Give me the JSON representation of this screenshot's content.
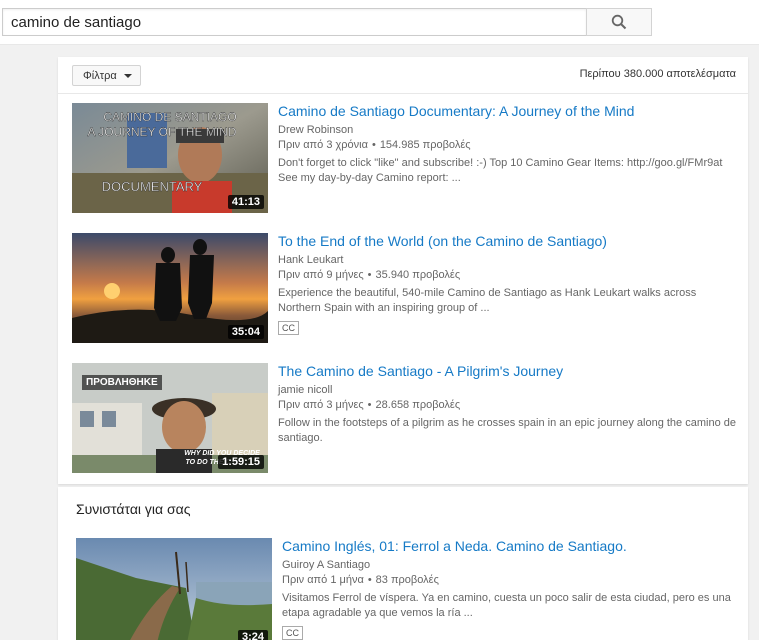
{
  "search": {
    "value": "camino de santiago"
  },
  "filters": {
    "label": "Φίλτρα",
    "results_count": "Περίπου 380.000 αποτελέσματα"
  },
  "results": [
    {
      "title": "Camino de Santiago Documentary: A Journey of the Mind",
      "channel": "Drew Robinson",
      "age": "Πριν από 3 χρόνια",
      "views": "154.985 προβολές",
      "description": "Don't forget to click \"like\" and subscribe! :-) Top 10 Camino Gear Items: http://goo.gl/FMr9at See my day-by-day Camino report: ...",
      "duration": "41:13",
      "thumb_text_1": "CAMINO DE SANTIAGO",
      "thumb_text_2": "A JOURNEY OF THE MIND",
      "thumb_text_3": "DOCUMENTARY"
    },
    {
      "title": "To the End of the World (on the Camino de Santiago)",
      "channel": "Hank Leukart",
      "age": "Πριν από 9 μήνες",
      "views": "35.940 προβολές",
      "description": "Experience the beautiful, 540-mile Camino de Santiago as Hank Leukart walks across Northern Spain with an inspiring group of ...",
      "duration": "35:04",
      "badge": "CC"
    },
    {
      "title": "The Camino de Santiago - A Pilgrim's Journey",
      "channel": "jamie nicoll",
      "age": "Πριν από 3 μήνες",
      "views": "28.658 προβολές",
      "description": "Follow in the footsteps of a pilgrim as he crosses spain in an epic journey along the camino de santiago.",
      "duration": "1:59:15",
      "watched_label": "ΠΡΟΒΛΗΘΗΚΕ",
      "thumb_caption_1": "WHY DID YOU DECIDE",
      "thumb_caption_2": "TO DO THE C"
    }
  ],
  "recommended": {
    "heading": "Συνιστάται για σας",
    "items": [
      {
        "title": "Camino Inglés, 01: Ferrol a Neda. Camino de Santiago.",
        "channel": "Guiroy A Santiago",
        "age": "Πριν από 1 μήνα",
        "views": "83 προβολές",
        "description": "Visitamos Ferrol de víspera. Ya en camino, cuesta un poco salir de esta ciudad, pero es una etapa agradable ya que vemos la ría ...",
        "duration": "3:24",
        "badge": "CC"
      }
    ]
  },
  "icons": {
    "search": "search-icon",
    "filter_caret": "caret-down-icon"
  },
  "colors": {
    "link_blue": "#167ac6",
    "background": "#f1f1f1"
  }
}
